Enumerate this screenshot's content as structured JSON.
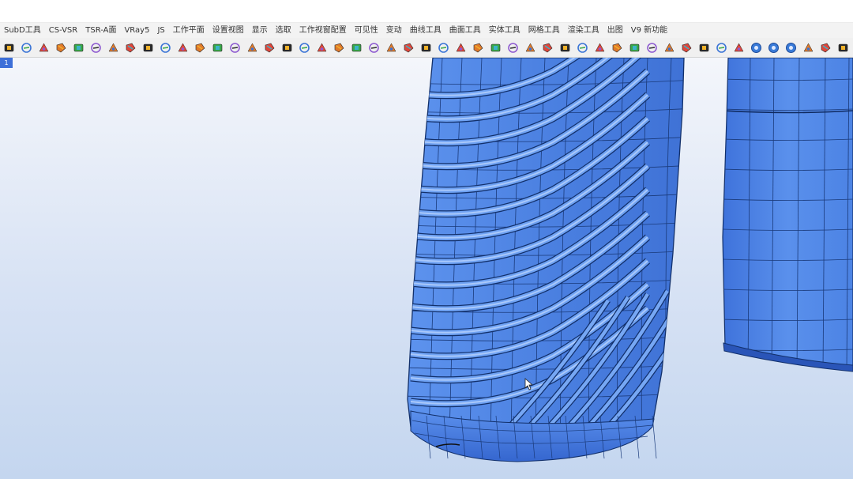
{
  "menu_tabs": [
    "SubD工具",
    "CS-VSR",
    "TSR-A面",
    "VRay5",
    "JS",
    "工作平面",
    "设置视图",
    "显示",
    "选取",
    "工作视窗配置",
    "可见性",
    "变动",
    "曲线工具",
    "曲面工具",
    "实体工具",
    "网格工具",
    "渲染工具",
    "出图",
    "V9 新功能"
  ],
  "toolbar_icons": [
    "box-icon",
    "cube-icon",
    "car-icon",
    "sphere-icon",
    "texture-icon",
    "scissors-icon",
    "gradient-icon",
    "cloth-icon",
    "twist-icon",
    "checker-icon",
    "frame-icon",
    "edit-icon",
    "target-icon",
    "pin-icon",
    "curve-icon",
    "move-icon",
    "cylinder-icon",
    "layers-icon",
    "plane-icon",
    "diamond-icon",
    "hexagon-icon",
    "monitor-icon",
    "gumball-icon",
    "view-icon",
    "bend-icon",
    "dots-icon",
    "pipe-icon",
    "saddle-icon",
    "stair-icon",
    "tree-icon",
    "dot-ring-icon",
    "rocket-icon",
    "flag-icon",
    "circle-icon",
    "square-icon",
    "cat-icon",
    "spiral-icon",
    "tag-icon",
    "cup-icon",
    "node-icon",
    "arc-icon",
    "person-icon",
    "block-icon",
    "gear-blue-icon",
    "gear-blue-icon",
    "gear-blue-icon",
    "home-icon",
    "window-icon",
    "grid-icon"
  ],
  "viewport": {
    "tab_label": "1"
  },
  "colors": {
    "model_fill": "#4f85e3",
    "model_edge": "#12306b",
    "ui_accent": "#3d6fd8"
  }
}
